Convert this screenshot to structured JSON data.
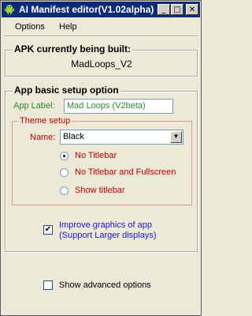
{
  "window": {
    "title": "AI Manifest editor(V1.02alpha)",
    "minimize_glyph": "_",
    "maximize_glyph": "□",
    "close_glyph": "✕"
  },
  "menu": {
    "options_label": "Options",
    "help_label": "Help"
  },
  "apk_section": {
    "title": "APK currently being built:",
    "name": "MadLoops_V2"
  },
  "setup_section": {
    "title": "App basic setup option",
    "app_label_caption": "App Label:",
    "app_label_value": "Mad Loops (V2beta)",
    "theme": {
      "title": "Theme setup",
      "name_caption": "Name:",
      "selected": "Black",
      "options": [
        {
          "label": "No Titlebar",
          "checked": true
        },
        {
          "label": "No Titlebar and Fullscreen",
          "checked": false
        },
        {
          "label": "Show titlebar",
          "checked": false
        }
      ]
    },
    "improve_graphics": {
      "checked": true,
      "line1": "Improve graphics of app",
      "line2": "(Support Larger displays)"
    }
  },
  "advanced": {
    "checked": false,
    "label": "Show advanced options"
  }
}
